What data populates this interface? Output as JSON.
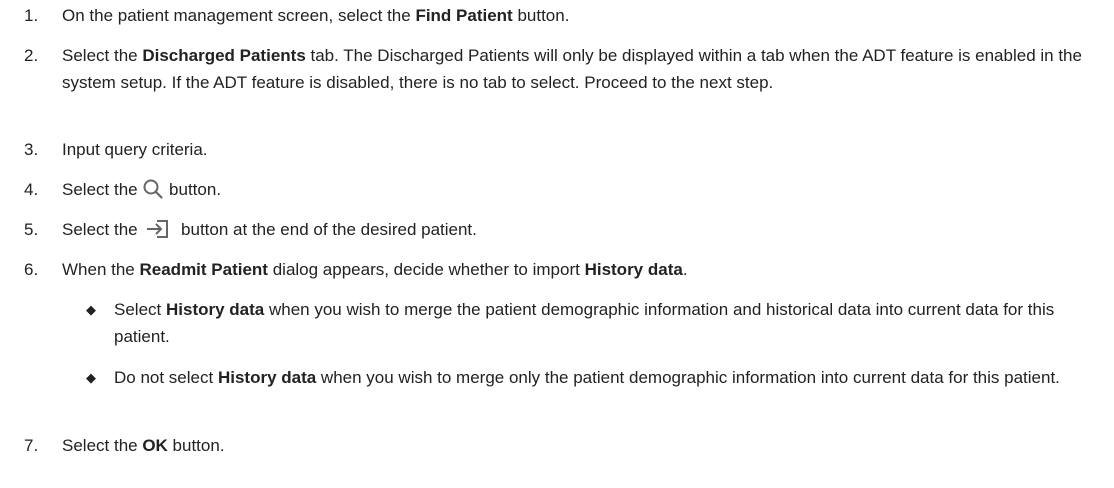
{
  "steps": [
    {
      "number": "1.",
      "parts": [
        "On the patient management screen, select the ",
        "Find Patient",
        " button."
      ]
    },
    {
      "number": "2.",
      "parts": [
        "Select the ",
        "Discharged Patients",
        " tab. The Discharged Patients will only be displayed within a tab when the ADT feature is enabled in the system setup. If the ADT feature is disabled, there is no tab to select. Proceed to the next step."
      ]
    },
    {
      "number": "3.",
      "text": "Input query criteria."
    },
    {
      "number": "4.",
      "before": "Select the ",
      "icon": "search-icon",
      "after": " button."
    },
    {
      "number": "5.",
      "before": "Select the ",
      "icon": "readmit-arrow-icon",
      "after": " button at the end of the desired patient."
    },
    {
      "number": "6.",
      "parts": [
        "When the ",
        "Readmit Patient",
        " dialog appears, decide whether to import ",
        "History data",
        "."
      ]
    },
    {
      "number": "7.",
      "parts": [
        "Select the ",
        "OK",
        " button."
      ]
    }
  ],
  "substeps": [
    {
      "bullet": "◆",
      "parts": [
        "Select ",
        "History data",
        " when you wish to merge the patient demographic information and historical data into current data for this patient."
      ]
    },
    {
      "bullet": "◆",
      "parts": [
        "Do not select ",
        "History data",
        " when you wish to merge only the patient demographic information into current data for this patient."
      ]
    }
  ],
  "colors": {
    "text": "#222222",
    "icon": "#666666"
  }
}
